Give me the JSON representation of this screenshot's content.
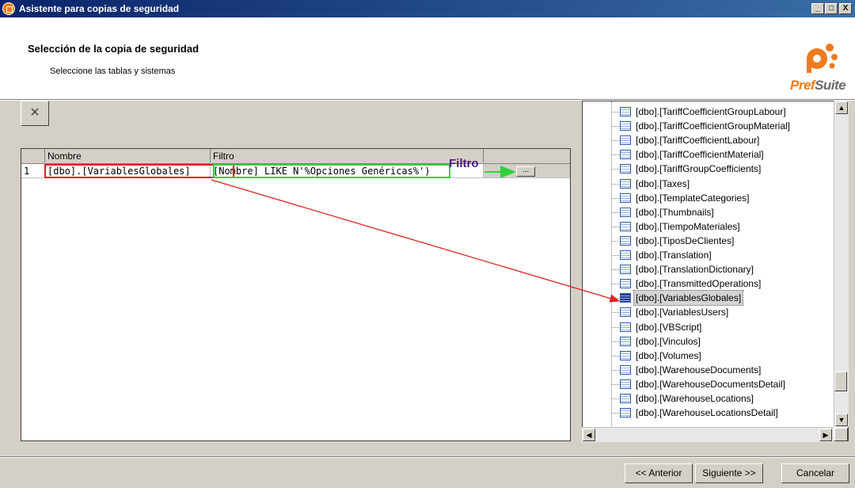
{
  "window": {
    "title": "Asistente para copias de seguridad",
    "controls": [
      "_",
      "□",
      "X"
    ]
  },
  "header": {
    "title": "Selección de la copia de seguridad",
    "subtitle": "Seleccione las tablas y sistemas"
  },
  "logo": {
    "text_pref": "Pref",
    "text_suite": "Suite"
  },
  "toolbar": {
    "delete_glyph": "×"
  },
  "grid": {
    "columns": [
      "Nombre",
      "Filtro"
    ],
    "rows": [
      {
        "num": "1",
        "nombre": "[dbo].[VariablesGlobales]",
        "filtro": "[Nombre] LIKE N'%Opciones Genéricas%')",
        "action": "..."
      }
    ]
  },
  "annotation": {
    "label": "Filtro"
  },
  "tree": {
    "items": [
      "[dbo].[TariffCoefficientGroupLabour]",
      "[dbo].[TariffCoefficientGroupMaterial]",
      "[dbo].[TariffCoefficientLabour]",
      "[dbo].[TariffCoefficientMaterial]",
      "[dbo].[TariffGroupCoefficients]",
      "[dbo].[Taxes]",
      "[dbo].[TemplateCategories]",
      "[dbo].[Thumbnails]",
      "[dbo].[TiempoMateriales]",
      "[dbo].[TiposDeClientes]",
      "[dbo].[Translation]",
      "[dbo].[TranslationDictionary]",
      "[dbo].[TransmittedOperations]",
      "[dbo].[VariablesGlobales]",
      "[dbo].[VariablesUsers]",
      "[dbo].[VBScript]",
      "[dbo].[Vinculos]",
      "[dbo].[Volumes]",
      "[dbo].[WarehouseDocuments]",
      "[dbo].[WarehouseDocumentsDetail]",
      "[dbo].[WarehouseLocations]",
      "[dbo].[WarehouseLocationsDetail]"
    ],
    "selected_index": 13
  },
  "footer": {
    "back": "<< Anterior",
    "next": "Siguiente >>",
    "cancel": "Cancelar"
  },
  "colors": {
    "title_bar": "#0a246a",
    "highlight_red": "#e02020",
    "highlight_green": "#30d040",
    "brand_orange": "#f07a1c"
  }
}
